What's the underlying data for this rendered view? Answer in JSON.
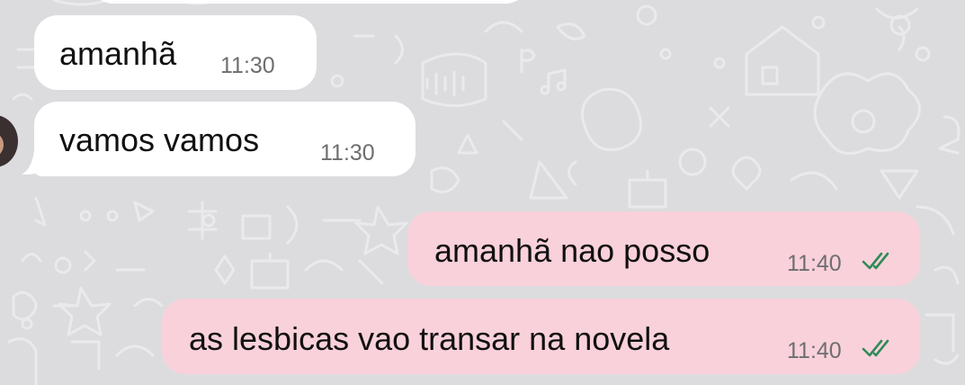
{
  "chat": {
    "messages": [
      {
        "direction": "incoming",
        "text": "amanhã",
        "time": "11:30"
      },
      {
        "direction": "incoming",
        "text": "vamos vamos",
        "time": "11:30"
      },
      {
        "direction": "outgoing",
        "text": "amanhã nao posso",
        "time": "11:40",
        "status": "read"
      },
      {
        "direction": "outgoing",
        "text": "as lesbicas vao transar na novela",
        "time": "11:40",
        "status": "read"
      }
    ]
  },
  "colors": {
    "wallpaper": "#dcdcdf",
    "incoming_bubble": "#ffffff",
    "outgoing_bubble": "#f9d1db",
    "read_ticks": "#2e8b57",
    "timestamp": "#6e6e70"
  },
  "icons": {
    "read_receipt": "double-check-icon",
    "avatar": "contact-avatar"
  }
}
